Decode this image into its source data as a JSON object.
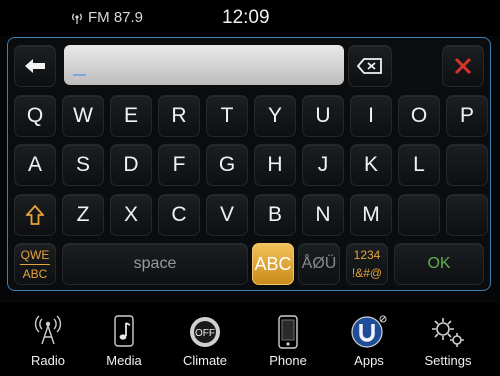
{
  "status": {
    "radio_text": "FM 87.9",
    "clock": "12:09"
  },
  "keyboard": {
    "input_value": "",
    "rows": [
      [
        "Q",
        "W",
        "E",
        "R",
        "T",
        "Y",
        "U",
        "I",
        "O",
        "P"
      ],
      [
        "A",
        "S",
        "D",
        "F",
        "G",
        "H",
        "J",
        "K",
        "L",
        ""
      ],
      [
        "Z",
        "X",
        "C",
        "V",
        "B",
        "N",
        "M",
        "",
        ""
      ]
    ],
    "mode_qwe": "QWE",
    "mode_abc_small": "ABC",
    "space_label": "space",
    "abc_label": "ABC",
    "accent_label": "ÅØÜ",
    "num_label_top": "1234",
    "num_label_bottom": "!&#@",
    "ok_label": "OK"
  },
  "nav": [
    {
      "label": "Radio",
      "icon": "radio-tower-icon"
    },
    {
      "label": "Media",
      "icon": "music-note-icon"
    },
    {
      "label": "Climate",
      "icon": "climate-off-icon"
    },
    {
      "label": "Phone",
      "icon": "phone-icon"
    },
    {
      "label": "Apps",
      "icon": "apps-icon"
    },
    {
      "label": "Settings",
      "icon": "gear-icon"
    }
  ],
  "climate_badge": "OFF",
  "colors": {
    "accent_blue": "#3e7fb2",
    "amber": "#e7a43a",
    "green": "#5fb04a",
    "red": "#d8342a"
  }
}
